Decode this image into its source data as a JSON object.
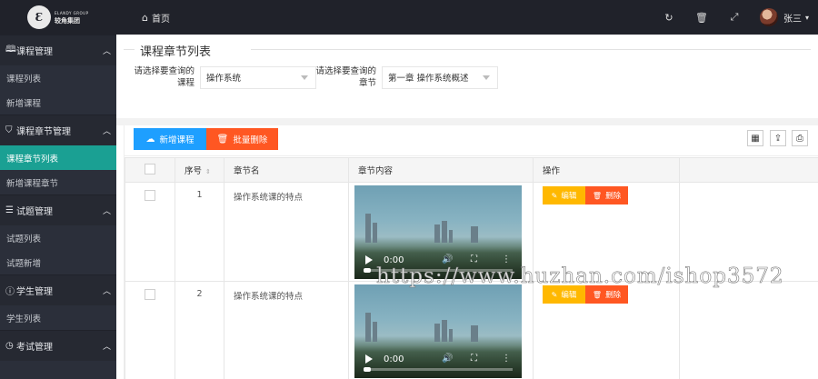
{
  "brand": {
    "logo_line1": "ELANDY GROUP",
    "logo_line2": "较角集团"
  },
  "header": {
    "home_label": "首页",
    "user_name": "张三"
  },
  "sidebar": {
    "sections": [
      {
        "label": "课程管理",
        "items": [
          "课程列表",
          "新增课程"
        ]
      },
      {
        "label": "课程章节管理",
        "items": [
          "课程章节列表",
          "新增课程章节"
        ]
      },
      {
        "label": "试题管理",
        "items": [
          "试题列表",
          "试题新增"
        ]
      },
      {
        "label": "学生管理",
        "items": [
          "学生列表"
        ]
      },
      {
        "label": "考试管理",
        "items": []
      }
    ],
    "active_item": "课程章节列表"
  },
  "page": {
    "title": "课程章节列表"
  },
  "filters": {
    "course": {
      "label": "请选择要查询的课程",
      "value": "操作系统"
    },
    "chapter": {
      "label": "请选择要查询的章节",
      "value": "第一章 操作系统概述"
    }
  },
  "toolbar": {
    "add_label": "新增课程",
    "batch_delete_label": "批量删除"
  },
  "table": {
    "headers": {
      "no": "序号",
      "name": "章节名",
      "content": "章节内容",
      "op": "操作"
    },
    "rows": [
      {
        "no": "1",
        "name": "操作系统课的特点",
        "video_time": "0:00",
        "edit": "编辑",
        "delete": "删除"
      },
      {
        "no": "2",
        "name": "操作系统课的特点",
        "video_time": "0:00",
        "edit": "编辑",
        "delete": "删除"
      }
    ]
  },
  "watermark": "https://www.huzhan.com/ishop3572",
  "colors": {
    "accent": "#1aa093",
    "primary": "#1e9fff",
    "danger": "#ff5722",
    "warning": "#ffb800",
    "sidebar": "#2b2f3a"
  }
}
